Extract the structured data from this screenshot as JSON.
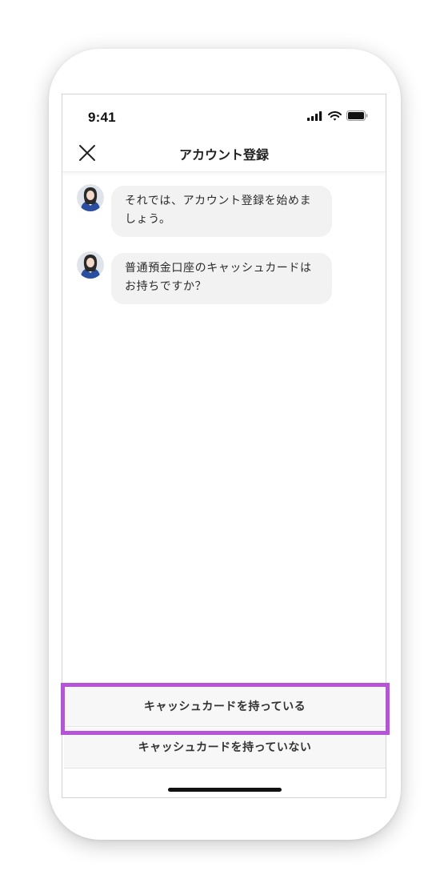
{
  "status_bar": {
    "time": "9:41"
  },
  "header": {
    "title": "アカウント登録"
  },
  "messages": [
    {
      "line1": "それでは、アカウント登録を始めま",
      "line2": "しょう。"
    },
    {
      "line1": "普通預金口座のキャッシュカードは",
      "line2": "お持ちですか？"
    }
  ],
  "options": {
    "has_card": "キャッシュカードを持っている",
    "no_card": "キャッシュカードを持っていない"
  },
  "colors": {
    "highlight": "#b554d6",
    "bubble": "#f2f2f2",
    "avatar_outfit": "#2a4fa0"
  },
  "icons": [
    "signal-icon",
    "wifi-icon",
    "battery-icon",
    "close-icon"
  ]
}
